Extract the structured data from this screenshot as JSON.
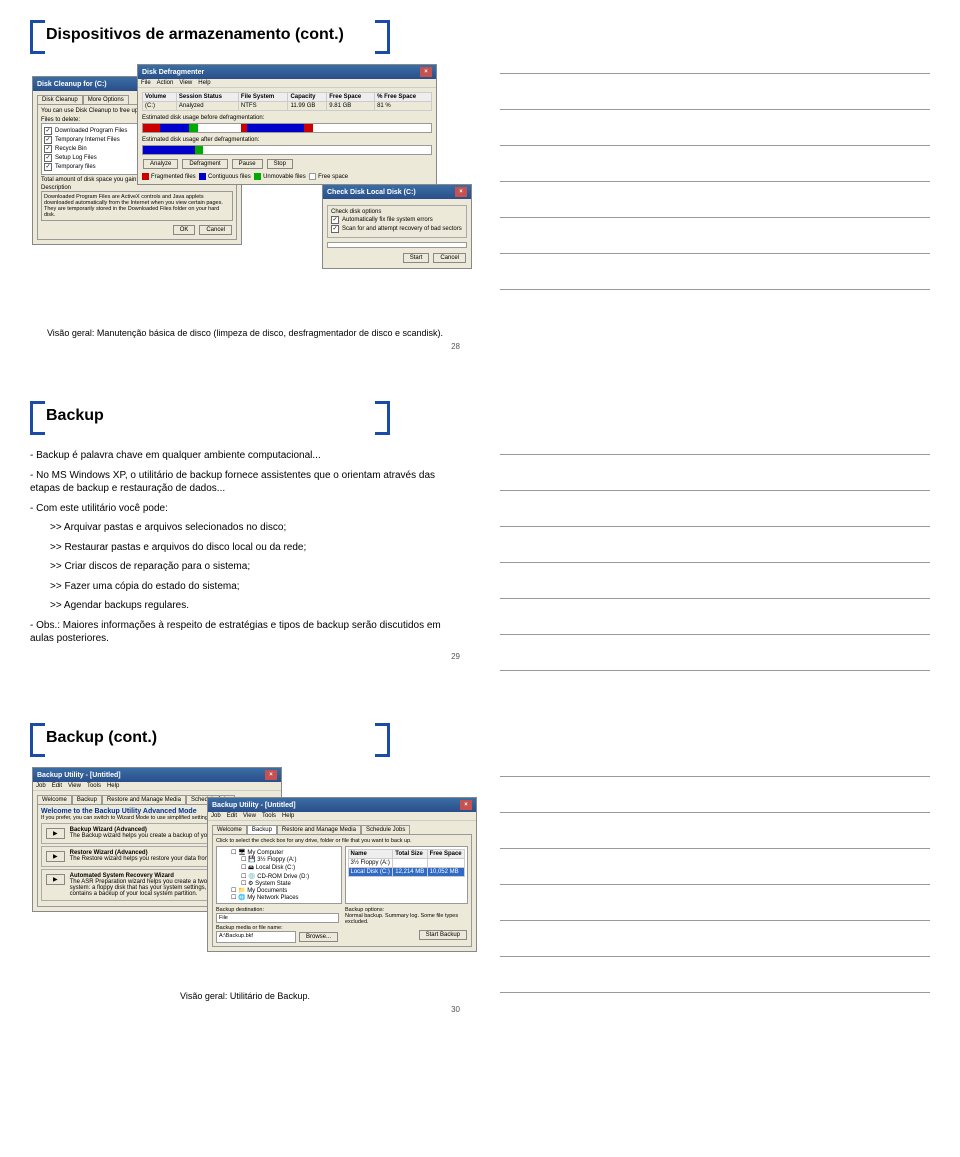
{
  "slide1": {
    "title": "Dispositivos de armazenamento (cont.)",
    "page": "28",
    "caption": "Visão geral: Manutenção básica de disco (limpeza de disco, desfragmentador de disco e scandisk).",
    "diskCleanup": {
      "windowTitle": "Disk Cleanup for (C:)",
      "tab1": "Disk Cleanup",
      "tab2": "More Options",
      "intro": "You can use Disk Cleanup to free up to 22 space on (C:).",
      "filesLabel": "Files to delete:",
      "items": [
        "Downloaded Program Files",
        "Temporary Internet Files",
        "Recycle Bin",
        "Setup Log Files",
        "Temporary files"
      ],
      "totalLabel": "Total amount of disk space you gain:",
      "descLabel": "Description",
      "desc": "Downloaded Program Files are ActiveX controls and Java applets downloaded automatically from the Internet when you view certain pages. They are temporarily stored in the Downloaded Files folder on your hard disk.",
      "ok": "OK",
      "cancel": "Cancel"
    },
    "defrag": {
      "windowTitle": "Disk Defragmenter",
      "menu": [
        "File",
        "Action",
        "View",
        "Help"
      ],
      "cols": [
        "Volume",
        "Session Status",
        "File System",
        "Capacity",
        "Free Space",
        "% Free Space"
      ],
      "row": [
        "(C:)",
        "Analyzed",
        "NTFS",
        "11.99 GB",
        "9.81 GB",
        "81 %"
      ],
      "before": "Estimated disk usage before defragmentation:",
      "after": "Estimated disk usage after defragmentation:",
      "btns": [
        "Analyze",
        "Defragment",
        "Pause",
        "Stop"
      ],
      "legend": [
        "Fragmented files",
        "Contiguous files",
        "Unmovable files",
        "Free space"
      ],
      "legendColors": [
        "#c00",
        "#00c",
        "#0a0",
        "#fff"
      ]
    },
    "chkdsk": {
      "windowTitle": "Check Disk Local Disk (C:)",
      "opts": "Check disk options",
      "o1": "Automatically fix file system errors",
      "o2": "Scan for and attempt recovery of bad sectors",
      "start": "Start",
      "cancel": "Cancel"
    }
  },
  "slide2": {
    "title": "Backup",
    "page": "29",
    "p1": "- Backup é palavra chave em qualquer ambiente computacional...",
    "p2": "- No MS Windows XP, o utilitário de backup fornece assistentes que o orientam através das etapas de backup e restauração de dados...",
    "p3": "- Com este utilitário você pode:",
    "b1": ">> Arquivar pastas e arquivos selecionados no disco;",
    "b2": ">> Restaurar pastas e arquivos do disco local ou da rede;",
    "b3": ">> Criar discos de reparação para o sistema;",
    "b4": ">> Fazer uma cópia do estado do sistema;",
    "b5": ">> Agendar backups regulares.",
    "p4": "- Obs.: Maiores informações à respeito de estratégias e tipos de backup serão discutidos em aulas posteriores."
  },
  "slide3": {
    "title": "Backup (cont.)",
    "page": "30",
    "caption": "Visão geral: Utilitário de Backup.",
    "backup1": {
      "windowTitle": "Backup Utility - [Untitled]",
      "menu": [
        "Job",
        "Edit",
        "View",
        "Tools",
        "Help"
      ],
      "tabs": [
        "Welcome",
        "Backup",
        "Restore and Manage Media",
        "Schedule Jobs"
      ],
      "welcome": "Welcome to the Backup Utility Advanced Mode",
      "sub": "If you prefer, you can switch to Wizard Mode to use simplified settings for backup or restore.",
      "w1t": "Backup Wizard (Advanced)",
      "w1d": "The Backup wizard helps you create a backup of your programs and files.",
      "w2t": "Restore Wizard (Advanced)",
      "w2d": "The Restore wizard helps you restore your data from a backup.",
      "w3t": "Automated System Recovery Wizard",
      "w3d": "The ASR Preparation wizard helps you create a two-part backup of your system: a floppy disk that has your system settings, and other media that contains a backup of your local system partition."
    },
    "backup2": {
      "windowTitle": "Backup Utility - [Untitled]",
      "menu": [
        "Job",
        "Edit",
        "View",
        "Tools",
        "Help"
      ],
      "tabs": [
        "Welcome",
        "Backup",
        "Restore and Manage Media",
        "Schedule Jobs"
      ],
      "hint": "Click to select the check box for any drive, folder or file that you want to back up.",
      "tree": [
        "My Computer",
        "3½ Floppy (A:)",
        "Local Disk (C:)",
        "CD-ROM Drive (D:)",
        "System State",
        "My Documents",
        "My Network Places"
      ],
      "cols": [
        "Name",
        "Total Size",
        "Free Space"
      ],
      "row1": [
        "3½ Floppy (A:)",
        "",
        ""
      ],
      "row2": [
        "Local Disk (C:)",
        "12,214 MB",
        "10,052 MB"
      ],
      "destLabel": "Backup destination:",
      "dest": "File",
      "mediaLabel": "Backup media or file name:",
      "media": "A:\\Backup.bkf",
      "browse": "Browse...",
      "optTitle": "Backup options:",
      "optText": "Normal backup. Summary log. Some file types excluded.",
      "start": "Start Backup"
    }
  }
}
